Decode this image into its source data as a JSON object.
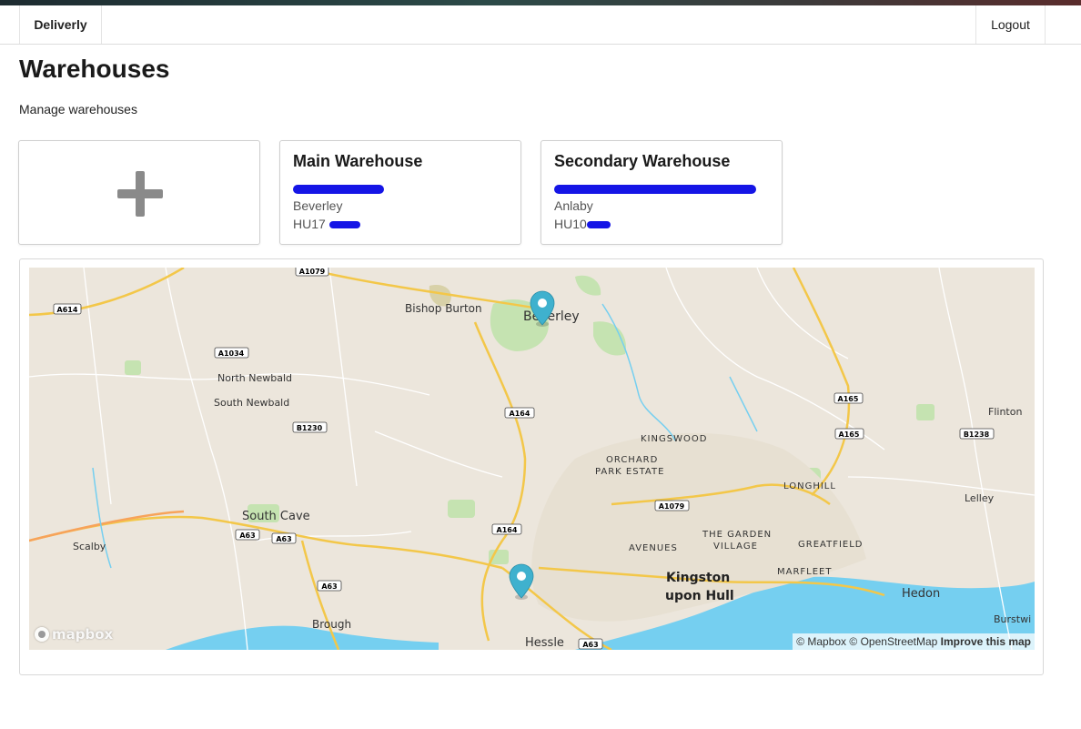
{
  "nav": {
    "brand": "Deliverly",
    "logout": "Logout"
  },
  "page": {
    "title": "Warehouses",
    "subtitle": "Manage warehouses"
  },
  "add_card": {
    "icon": "plus-icon"
  },
  "warehouses": [
    {
      "name": "Main Warehouse",
      "city": "Beverley",
      "postcode_prefix": "HU17"
    },
    {
      "name": "Secondary Warehouse",
      "city": "Anlaby",
      "postcode_prefix": "HU10"
    }
  ],
  "map": {
    "pin_color": "#3fb1ce",
    "labels": {
      "bishop_burton": "Bishop Burton",
      "beverley": "Beverley",
      "north_newbald": "North Newbald",
      "south_newbald": "South Newbald",
      "south_cave": "South Cave",
      "scalby": "Scalby",
      "brough": "Brough",
      "hessle": "Hessle",
      "kingswood": "KINGSWOOD",
      "orchard": "ORCHARD",
      "park_estate": "PARK ESTATE",
      "avenues": "AVENUES",
      "the_garden": "THE GARDEN",
      "village": "VILLAGE",
      "greatfield": "GREATFIELD",
      "longhill": "LONGHILL",
      "marfleet": "MARFLEET",
      "kingston": "Kingston",
      "upon_hull": "upon Hull",
      "hedon": "Hedon",
      "flinton": "Flinton",
      "lelley": "Lelley",
      "burstwick": "Burstwi"
    },
    "roads": {
      "a1079_top": "A1079",
      "a614": "A614",
      "a1034": "A1034",
      "b1230": "B1230",
      "a164_n": "A164",
      "a164_s": "A164",
      "a63_w": "A63",
      "a63_m": "A63",
      "a63_s": "A63",
      "a63_b": "A63",
      "a1079_hull": "A1079",
      "a165_n": "A165",
      "a165_s": "A165",
      "b1238": "B1238"
    },
    "attribution": {
      "mapbox": "© Mapbox",
      "osm": "© OpenStreetMap",
      "improve": "Improve this map"
    },
    "logo": "mapbox"
  }
}
